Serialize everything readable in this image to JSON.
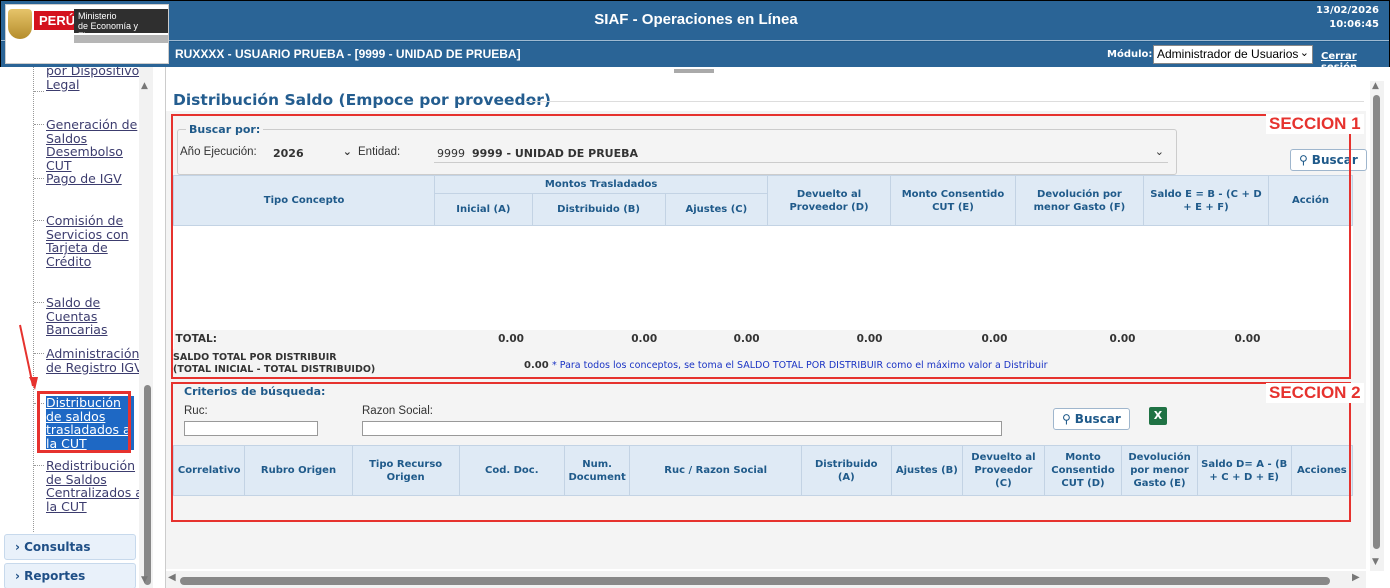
{
  "header": {
    "logo": {
      "country": "PERÚ",
      "ministry_line1": "Ministerio",
      "ministry_line2": "de Economía y Finanzas"
    },
    "title": "SIAF - Operaciones en Línea",
    "date": "13/02/2026",
    "time": "10:06:45",
    "user_line": "RUXXXX - USUARIO PRUEBA - [9999 - UNIDAD DE PRUEBA]",
    "modulo_label": "Módulo:",
    "modulo_value": "Administrador de Usuarios",
    "logout": "Cerrar sesión",
    "colors": {
      "header_bg": "#2a6496",
      "accent_red": "#e6322e"
    }
  },
  "sidebar": {
    "items": [
      {
        "label": "por Dispositivo Legal"
      },
      {
        "label": "Generación de Saldos Desembolso CUT"
      },
      {
        "label": "Pago de IGV"
      },
      {
        "label": "Comisión de Servicios con Tarjeta de Crédito"
      },
      {
        "label": "Saldo de Cuentas Bancarias"
      },
      {
        "label": "Administración de Registro IGV"
      },
      {
        "label": "Distribución de saldos trasladados a la CUT",
        "selected": true
      },
      {
        "label": "Redistribución de Saldos Centralizados a la CUT"
      }
    ],
    "accordions": [
      "Consultas",
      "Reportes"
    ]
  },
  "main": {
    "title": "Distribución Saldo (Empoce por proveedor)",
    "seccion1": {
      "label": "SECCION 1",
      "buscar_por": "Buscar por:",
      "anio_label": "Año Ejecución:",
      "anio_value": "2026",
      "entidad_label": "Entidad:",
      "entidad_code": "9999",
      "entidad_value": "9999 - UNIDAD DE PRUEBA",
      "buscar_button": "Buscar",
      "table": {
        "group_header": "Montos Trasladados",
        "columns": [
          "Tipo Concepto",
          "Inicial (A)",
          "Distribuido (B)",
          "Ajustes (C)",
          "Devuelto al Proveedor (D)",
          "Monto Consentido CUT (E)",
          "Devolución por menor Gasto (F)",
          "Saldo E = B - (C + D + E + F)",
          "Acción"
        ],
        "total_label": "TOTAL:",
        "totals": [
          "0.00",
          "0.00",
          "0.00",
          "0.00",
          "0.00",
          "0.00",
          "0.00"
        ]
      },
      "saldo_total_line1": "SALDO TOTAL POR DISTRIBUIR",
      "saldo_total_line2": "(TOTAL INICIAL - TOTAL DISTRIBUIDO)",
      "saldo_total_value": "0.00",
      "saldo_note": "* Para todos los conceptos, se toma el SALDO TOTAL POR DISTRIBUIR como el máximo valor a Distribuir"
    },
    "seccion2": {
      "label": "SECCION 2",
      "criterios": "Criterios de búsqueda:",
      "ruc_label": "Ruc:",
      "razon_label": "Razon Social:",
      "buscar_button": "Buscar",
      "excel_icon": "excel-icon",
      "table": {
        "columns": [
          "Correlativo",
          "Rubro Origen",
          "Tipo Recurso Origen",
          "Cod. Doc.",
          "Num. Document",
          "Ruc / Razon Social",
          "Distribuido (A)",
          "Ajustes (B)",
          "Devuelto al Proveedor (C)",
          "Monto Consentido CUT (D)",
          "Devolución por menor Gasto (E)",
          "Saldo D= A - (B + C + D + E)",
          "Acciones"
        ]
      }
    }
  }
}
